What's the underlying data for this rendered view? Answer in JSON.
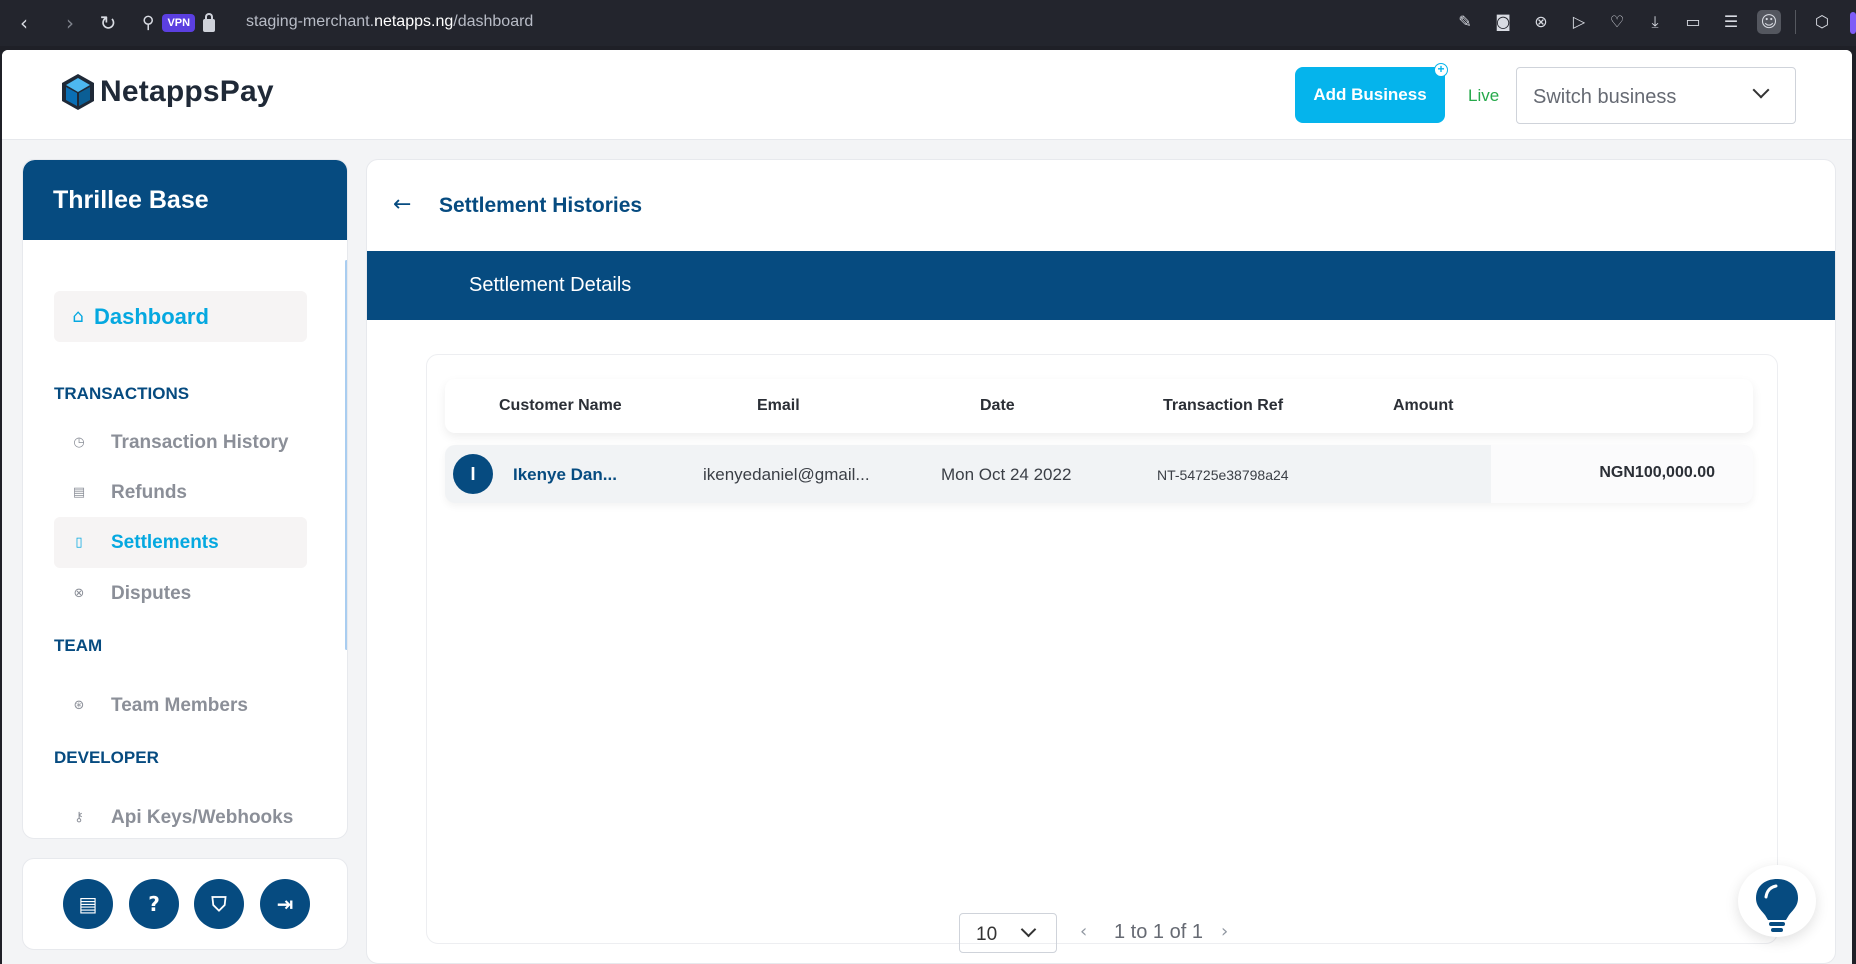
{
  "browser": {
    "vpn_label": "VPN",
    "url_prefix": "staging-merchant.",
    "url_host": "netapps.ng",
    "url_path": "/dashboard"
  },
  "header": {
    "brand": "NetappsPay",
    "add_business": "Add Business",
    "mode": "Live",
    "switch_placeholder": "Switch business"
  },
  "sidebar": {
    "business_name": "Thrillee Base",
    "dashboard": "Dashboard",
    "sections": {
      "transactions": "TRANSACTIONS",
      "team": "TEAM",
      "developer": "DEVELOPER"
    },
    "items": {
      "transaction_history": "Transaction History",
      "refunds": "Refunds",
      "settlements": "Settlements",
      "disputes": "Disputes",
      "team_members": "Team Members",
      "api_keys": "Api Keys/Webhooks"
    }
  },
  "main": {
    "page_title": "Settlement Histories",
    "section_title": "Settlement Details",
    "columns": {
      "customer": "Customer Name",
      "email": "Email",
      "date": "Date",
      "ref": "Transaction Ref",
      "amount": "Amount"
    },
    "rows": [
      {
        "initial": "I",
        "customer": "Ikenye Dan...",
        "email": "ikenyedaniel@gmail...",
        "date": "Mon Oct 24 2022",
        "ref": "NT-54725e38798a24",
        "amount": "NGN100,000.00"
      }
    ],
    "pagination": {
      "page_size": "10",
      "range": "1 to 1 of 1"
    }
  },
  "colors": {
    "brand_navy": "#064b80",
    "accent_blue": "#05b4ec",
    "live_green": "#26a94b"
  }
}
